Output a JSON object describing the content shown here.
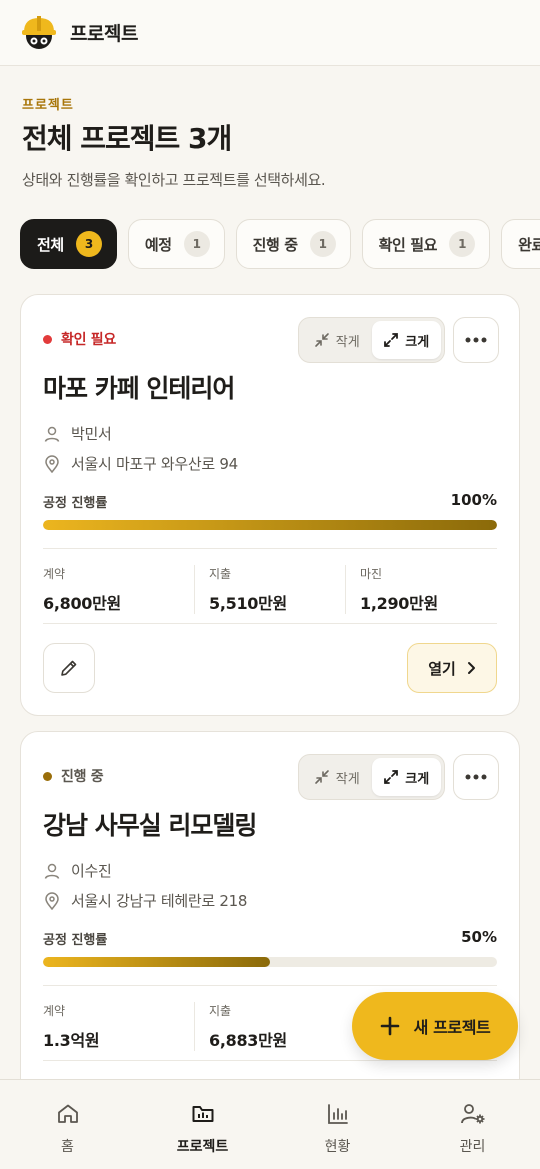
{
  "app": {
    "title": "프로젝트"
  },
  "header": {
    "eyebrow": "프로젝트",
    "title": "전체 프로젝트 3개",
    "subtitle": "상태와 진행률을 확인하고 프로젝트를 선택하세요."
  },
  "filters": [
    {
      "label": "전체",
      "count": "3",
      "active": true
    },
    {
      "label": "예정",
      "count": "1"
    },
    {
      "label": "진행 중",
      "count": "1"
    },
    {
      "label": "확인 필요",
      "count": "1"
    },
    {
      "label": "완료",
      "count": ""
    }
  ],
  "size_toggle": {
    "small": "작게",
    "large": "크게"
  },
  "progress_label": "공정 진행률",
  "open_label": "열기",
  "projects": [
    {
      "status": "확인 필요",
      "status_color": "#e23b3b",
      "status_text_color": "#c62828",
      "name": "마포 카페 인테리어",
      "manager": "박민서",
      "address": "서울시 마포구 와우산로 94",
      "progress": 1.0,
      "progress_text": "100%",
      "stats": [
        {
          "label": "계약",
          "value": "6,800만원"
        },
        {
          "label": "지출",
          "value": "5,510만원"
        },
        {
          "label": "마진",
          "value": "1,290만원"
        }
      ]
    },
    {
      "status": "진행 중",
      "status_color": "#9a6e0a",
      "status_text_color": "#5b5750",
      "name": "강남 사무실 리모델링",
      "manager": "이수진",
      "address": "서울시 강남구 테헤란로 218",
      "progress": 0.5,
      "progress_text": "50%",
      "stats": [
        {
          "label": "계약",
          "value": "1.3억원"
        },
        {
          "label": "지출",
          "value": "6,883만원"
        }
      ]
    }
  ],
  "fab": {
    "label": "새 프로젝트"
  },
  "nav": [
    {
      "label": "홈",
      "icon": "home-icon"
    },
    {
      "label": "프로젝트",
      "icon": "folder-chart-icon",
      "active": true
    },
    {
      "label": "현황",
      "icon": "bar-chart-icon"
    },
    {
      "label": "관리",
      "icon": "user-settings-icon"
    }
  ],
  "colors": {
    "accent": "#efb81d",
    "dark": "#1c1b19"
  }
}
